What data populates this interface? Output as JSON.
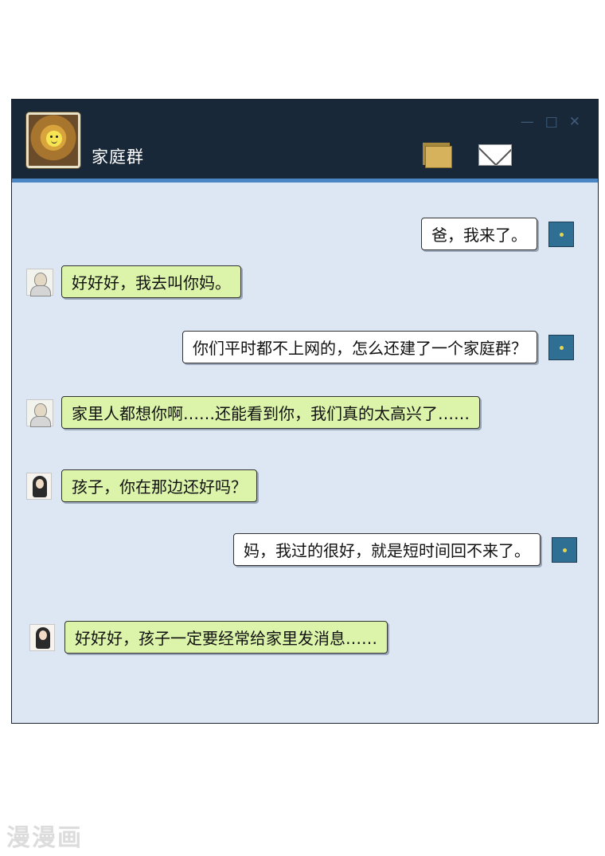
{
  "window": {
    "title": "家庭群",
    "controls": {
      "minimize": "—",
      "maximize": "□",
      "close": "✕"
    },
    "icons": [
      "folder-icon",
      "mail-icon"
    ],
    "colors": {
      "titlebar": "#182839",
      "accent": "#4b86c4",
      "chat_bg": "#dde6f3",
      "bubble_green": "#dcf3aa",
      "bubble_white": "#ffffff"
    }
  },
  "messages": [
    {
      "sender": "me",
      "text": "爸，我来了。"
    },
    {
      "sender": "dad",
      "text": "好好好，我去叫你妈。"
    },
    {
      "sender": "me",
      "text": "你们平时都不上网的，怎么还建了一个家庭群？"
    },
    {
      "sender": "dad",
      "text": "家里人都想你啊……还能看到你，我们真的太高兴了……"
    },
    {
      "sender": "mom",
      "text": "孩子，你在那边还好吗？"
    },
    {
      "sender": "me",
      "text": "妈，我过的很好，就是短时间回不来了。"
    },
    {
      "sender": "mom",
      "text": "好好好，孩子一定要经常给家里发消息……"
    }
  ],
  "watermark": "漫漫画"
}
